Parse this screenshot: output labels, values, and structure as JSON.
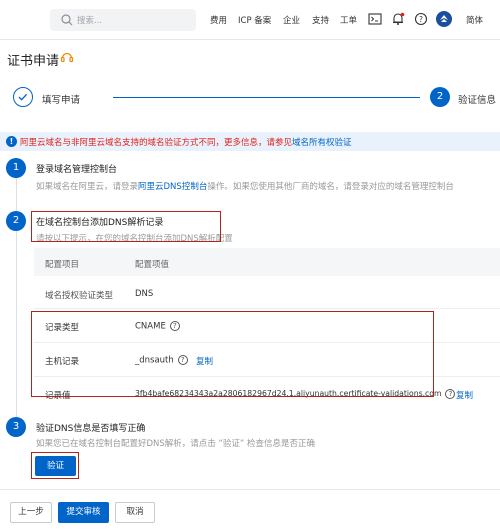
{
  "topbar": {
    "search_placeholder": "搜索...",
    "nav": [
      "费用",
      "ICP 备案",
      "企业",
      "支持",
      "工单"
    ],
    "lang": "简体"
  },
  "page": {
    "title": "证书申请"
  },
  "steps": [
    {
      "label": "填写申请",
      "state": "done"
    },
    {
      "label": "验证信息",
      "number": "2"
    }
  ],
  "notice": {
    "text": "阿里云域名与非阿里云域名支持的域名验证方式不同，更多信息，请参见",
    "link": "域名所有权验证"
  },
  "sections": [
    {
      "number": "1",
      "title": "登录域名管理控制台",
      "desc_pre": "如果域名在阿里云，请登录",
      "desc_link": "阿里云DNS控制台",
      "desc_post": "操作。如果您使用其他厂商的域名，请登录对应的域名管理控制台"
    },
    {
      "number": "2",
      "title": "在域名控制台添加DNS解析记录",
      "desc": "请按以下提示，在您的域名控制台添加DNS解析配置"
    },
    {
      "number": "3",
      "title": "验证DNS信息是否填写正确",
      "desc": "如果您已在域名控制台配置好DNS解析，请点击 “验证” 检查信息是否正确"
    }
  ],
  "table": {
    "headers": [
      "配置项目",
      "配置项值"
    ],
    "rows": [
      {
        "name": "域名授权验证类型",
        "value": "DNS"
      },
      {
        "name": "记录类型",
        "value": "CNAME",
        "help": "?"
      },
      {
        "name": "主机记录",
        "value": "_dnsauth",
        "help": "?",
        "copy": "复制"
      },
      {
        "name": "记录值",
        "value": "3fb4bafe68234343a2a2806182967d24.1.aliyunauth.certificate-validations.com",
        "help": "?",
        "copy": "复制"
      }
    ]
  },
  "buttons": {
    "verify": "验证",
    "prev": "上一步",
    "submit": "提交审核",
    "cancel": "取消"
  },
  "colors": {
    "primary": "#0064c8",
    "annotation": "#b0241d",
    "warning": "#e2231a"
  }
}
